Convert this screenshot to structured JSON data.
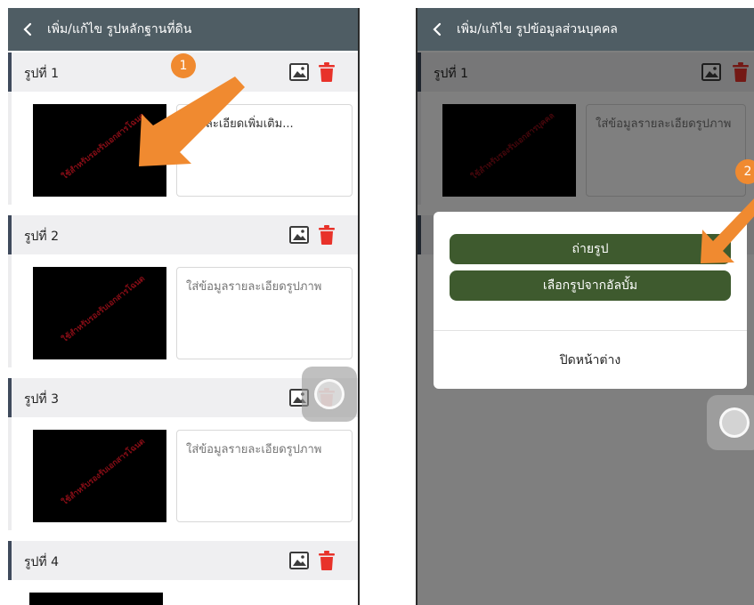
{
  "left_screen": {
    "header": {
      "title": "เพิ่ม/แก้ไข รูปหลักฐานที่ดิน"
    },
    "sections": [
      {
        "title": "รูปที่ 1",
        "photo_watermark": "ใช้สำหรับรองรับเอกสารโฉนด",
        "description": "รายละเอียดเพิ่มเติม..."
      },
      {
        "title": "รูปที่ 2",
        "photo_watermark": "ใช้สำหรับรองรับเอกสารโฉนด",
        "placeholder": "ใส่ข้อมูลรายละเอียดรูปภาพ"
      },
      {
        "title": "รูปที่ 3",
        "photo_watermark": "ใช้สำหรับรองรับเอกสารโฉนด",
        "placeholder": "ใส่ข้อมูลรายละเอียดรูปภาพ"
      },
      {
        "title": "รูปที่ 4"
      }
    ],
    "step_badge": "1"
  },
  "right_screen": {
    "header": {
      "title": "เพิ่ม/แก้ไข รูปข้อมูลส่วนบุคคล"
    },
    "section": {
      "title": "รูปที่ 1",
      "photo_watermark": "ใช้สำหรับรองรับเอกสารบุคคล",
      "placeholder": "ใส่ข้อมูลรายละเอียดรูปภาพ"
    },
    "action_sheet": {
      "take_photo": "ถ่ายรูป",
      "choose_album": "เลือกรูปจากอัลบั้ม",
      "close": "ปิดหน้าต่าง"
    },
    "step_badge": "2"
  },
  "colors": {
    "header_bg": "#4f5d64",
    "accent_green": "#3e5a2e",
    "trash_red": "#e8322a",
    "badge_orange": "#f08a30",
    "section_bar": "#3f4a5c"
  },
  "icons": {
    "back": "chevron-left-icon",
    "image": "image-icon",
    "trash": "trash-icon"
  }
}
